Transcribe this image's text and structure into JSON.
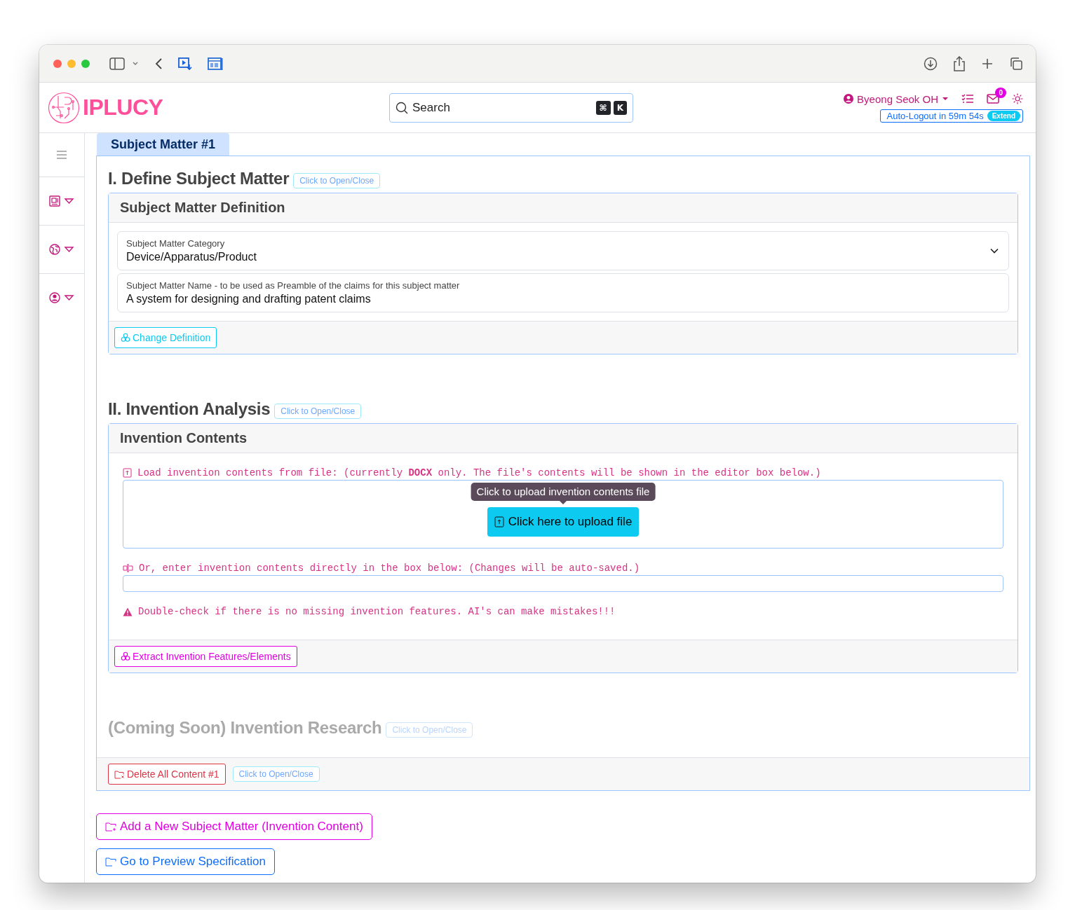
{
  "header": {
    "logo": "IPLUCY",
    "search": {
      "placeholder": "Search",
      "keys": [
        "⌘",
        "K"
      ]
    },
    "user": {
      "name": "Byeong Seok OH"
    },
    "mail_count": "0",
    "auto_logout": {
      "text": "Auto-Logout in 59m 54s",
      "action": "Extend"
    }
  },
  "tabs": [
    {
      "label": "Subject Matter #1",
      "selected": true
    }
  ],
  "sections": [
    {
      "kind": "definition",
      "title": "I. Define Subject Matter",
      "toggle": "Click to Open/Close",
      "disabled": false,
      "panel": {
        "header": "Subject Matter Definition",
        "fields": [
          {
            "kind": "select",
            "label": "Subject Matter Category",
            "value": "Device/Apparatus/Product"
          },
          {
            "kind": "text",
            "label": "Subject Matter Name - to be used as Preamble of the claims for this subject matter",
            "value": "A system for designing and drafting patent claims"
          }
        ],
        "action": "Change Definition"
      }
    },
    {
      "kind": "analysis",
      "title": "II. Invention Analysis",
      "toggle": "Click to Open/Close",
      "disabled": false,
      "panel": {
        "header": "Invention Contents",
        "upload_note": "Load invention contents from file: (currently **DOCX** only. The file's contents will be shown in the editor box below.)",
        "upload_button": "Click here to upload file",
        "tooltip": "Click to upload invention contents file",
        "direct_note": "Or, enter invention contents directly in the box below: (Changes will be auto-saved.)",
        "warning": "Double-check if there is no missing invention features. AI's can make mistakes!!!",
        "action": "Extract Invention Features/Elements"
      }
    },
    {
      "kind": "research",
      "title": "(Coming Soon) Invention Research",
      "toggle": "Click to Open/Close",
      "disabled": true
    }
  ],
  "card_footer": {
    "delete": "Delete All Content #1",
    "toggle": "Click to Open/Close"
  },
  "actions": [
    {
      "kind": "add",
      "label": "Add a New Subject Matter (Invention Content)"
    },
    {
      "kind": "preview",
      "label": "Go to Preview Specification"
    }
  ]
}
